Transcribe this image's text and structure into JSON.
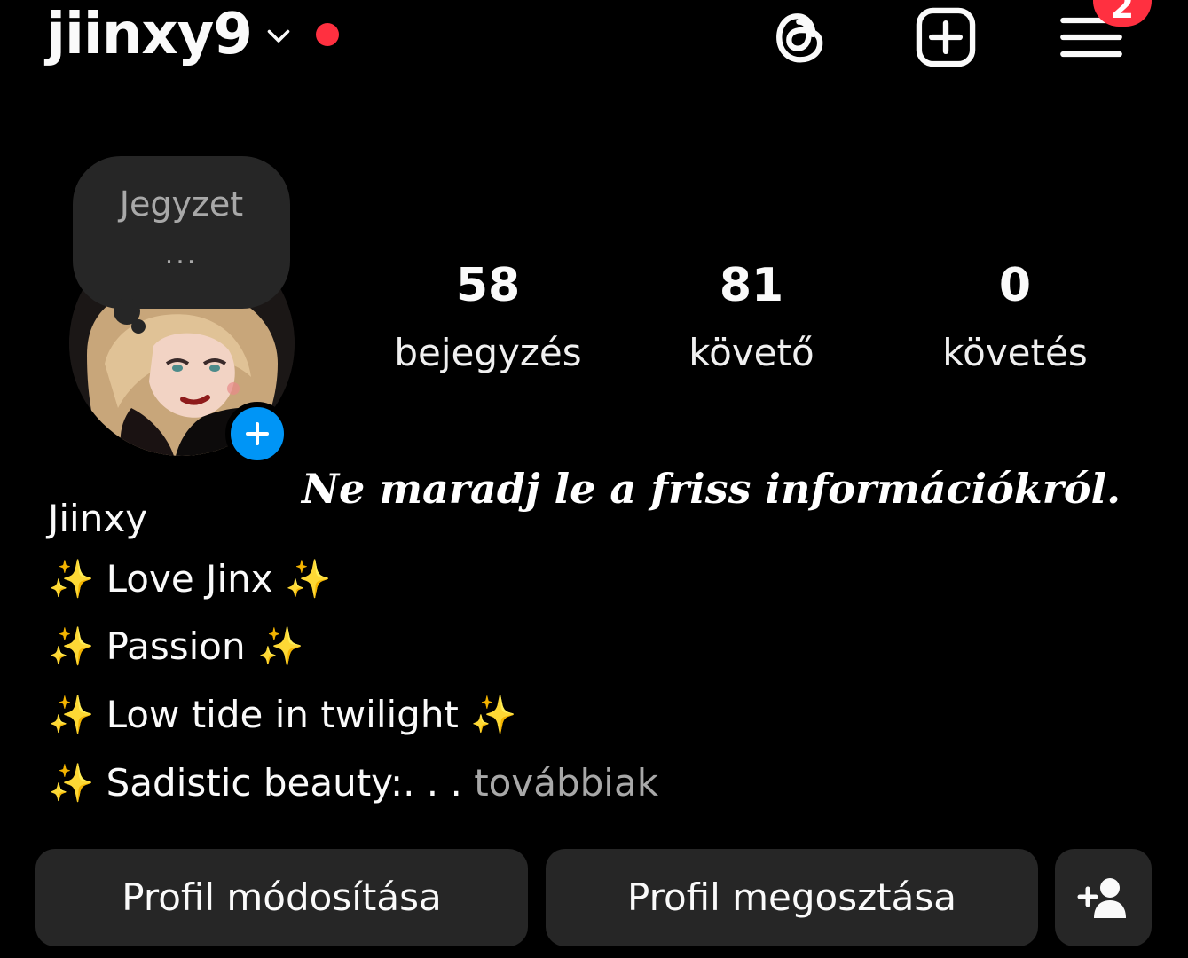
{
  "header": {
    "username": "jiinxy9",
    "menu_badge": "2",
    "accent_color": "#ff3040"
  },
  "note": {
    "label": "Jegyzet",
    "ellipsis": "..."
  },
  "stats": {
    "posts": {
      "value": "58",
      "label": "bejegyzés"
    },
    "followers": {
      "value": "81",
      "label": "követő"
    },
    "following": {
      "value": "0",
      "label": "követés"
    }
  },
  "overlay_text": "Ne maradj le a friss információkról.",
  "profile": {
    "display_name": "Jiinxy",
    "bio_lines": [
      {
        "sparkle_left": "✨",
        "text": " Love Jinx ",
        "sparkle_right": "✨"
      },
      {
        "sparkle_left": "✨",
        "text": " Passion ",
        "sparkle_right": "✨"
      },
      {
        "sparkle_left": "✨",
        "text": " Low tide in twilight ",
        "sparkle_right": "✨"
      },
      {
        "sparkle_left": "✨",
        "text": " Sadistic beauty:. . . ",
        "more": "továbbiak"
      }
    ]
  },
  "buttons": {
    "edit_profile": "Profil módosítása",
    "share_profile": "Profil megosztása"
  },
  "icons": {
    "threads": "threads-icon",
    "create": "plus-square-icon",
    "menu": "hamburger-menu-icon",
    "add_story": "plus-icon",
    "discover_people": "add-person-icon"
  },
  "brand_blue": "#0095f6"
}
